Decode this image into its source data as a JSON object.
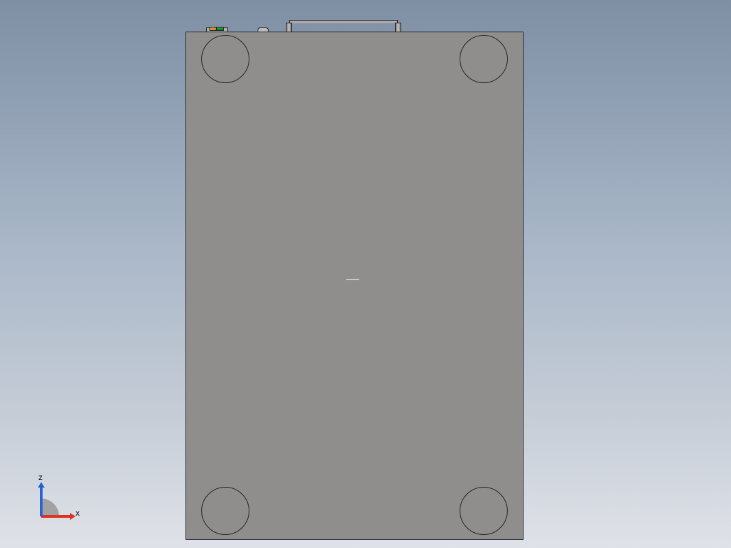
{
  "viewport": {
    "model": {
      "feet": [
        "top-left",
        "top-right",
        "bottom-left",
        "bottom-right"
      ],
      "handle_posts": 2
    },
    "triad": {
      "axes": {
        "x": {
          "label": "x",
          "color": "#d33222"
        },
        "z": {
          "label": "z",
          "color": "#2b62d2"
        },
        "y": {
          "visible": false
        }
      }
    }
  }
}
